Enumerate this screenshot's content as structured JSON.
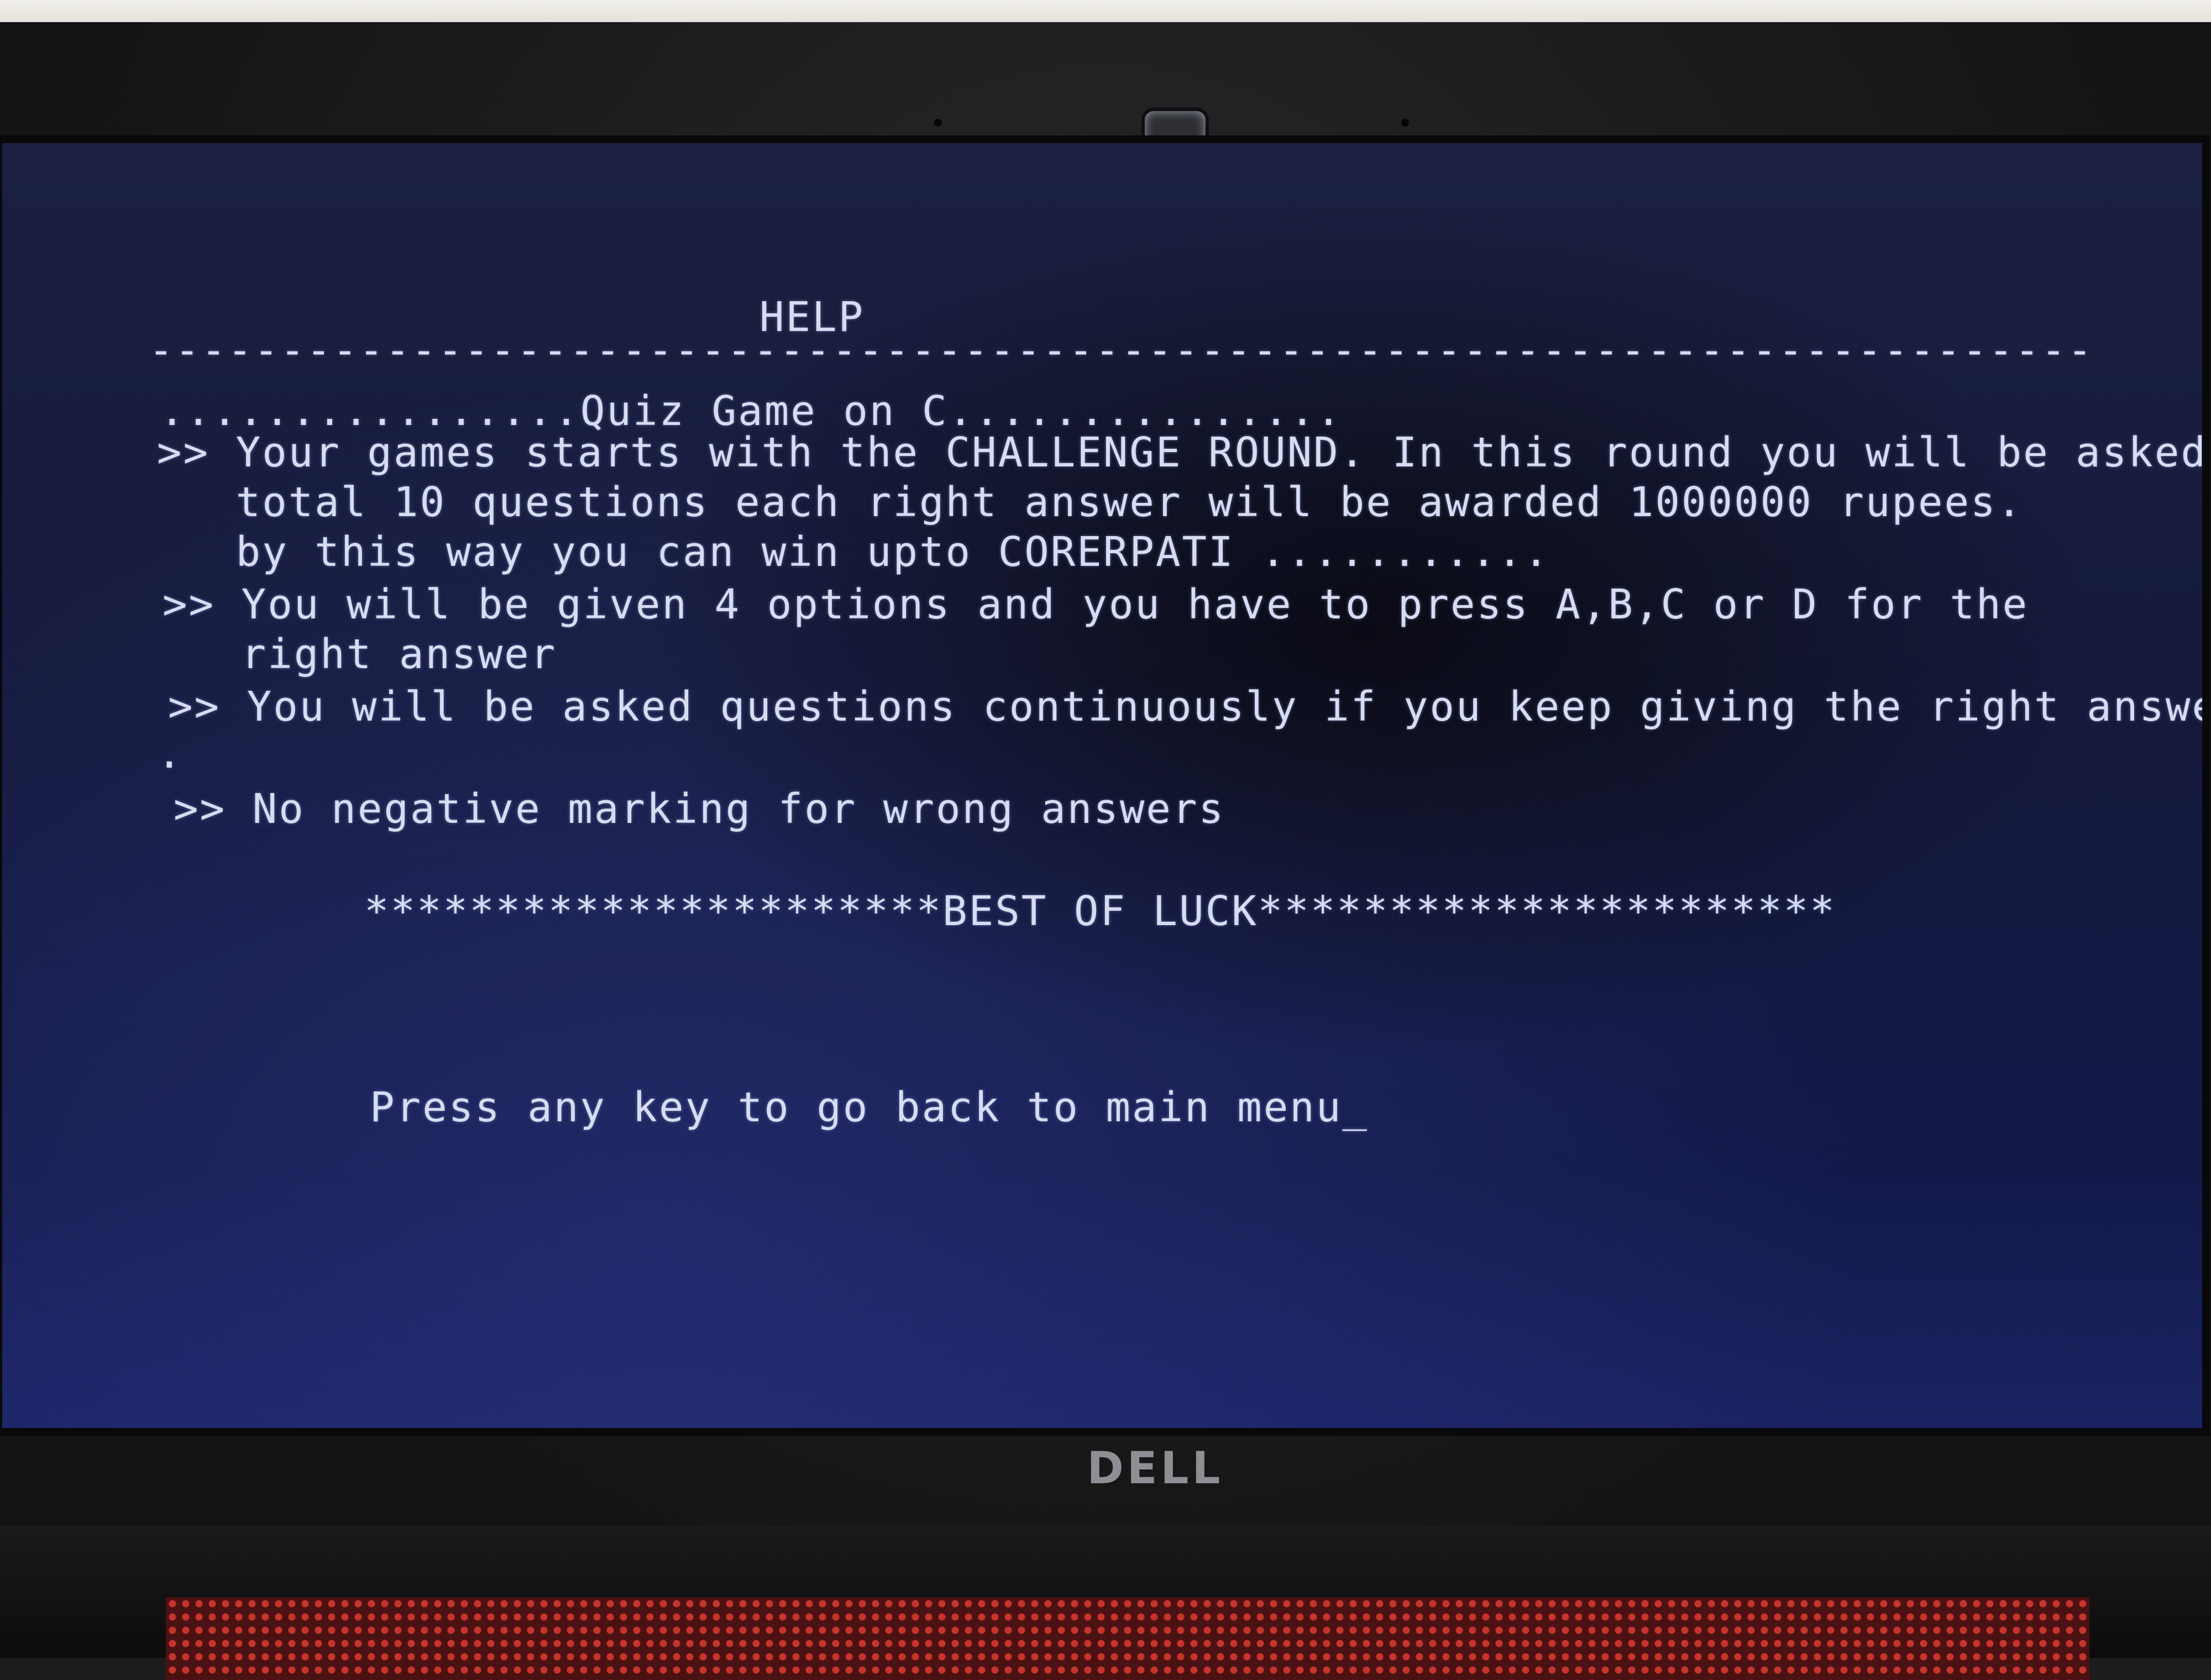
{
  "terminal": {
    "title": "HELP",
    "separator": "--------------------------------------------------------------------------",
    "subtitle": "................Quiz Game on C...............",
    "rules": [
      ">> Your games starts with the CHALLENGE ROUND. In this round you will be asked",
      "   total 10 questions each right answer will be awarded 1000000 rupees.",
      "   by this way you can win upto CORERPATI ...........",
      ">> You will be given 4 options and you have to press A,B,C or D for the",
      "   right answer",
      ">> You will be asked questions continuously if you keep giving the right answer",
      ".",
      ">> No negative marking for wrong answers"
    ],
    "banner": "**********************BEST OF LUCK**********************",
    "prompt": "Press any key to go back to main menu_"
  },
  "device": {
    "brand_logo": "DELL"
  },
  "colors": {
    "screen_background": "#151a3c",
    "terminal_text": "#d6dcf2",
    "bezel": "#141415"
  }
}
